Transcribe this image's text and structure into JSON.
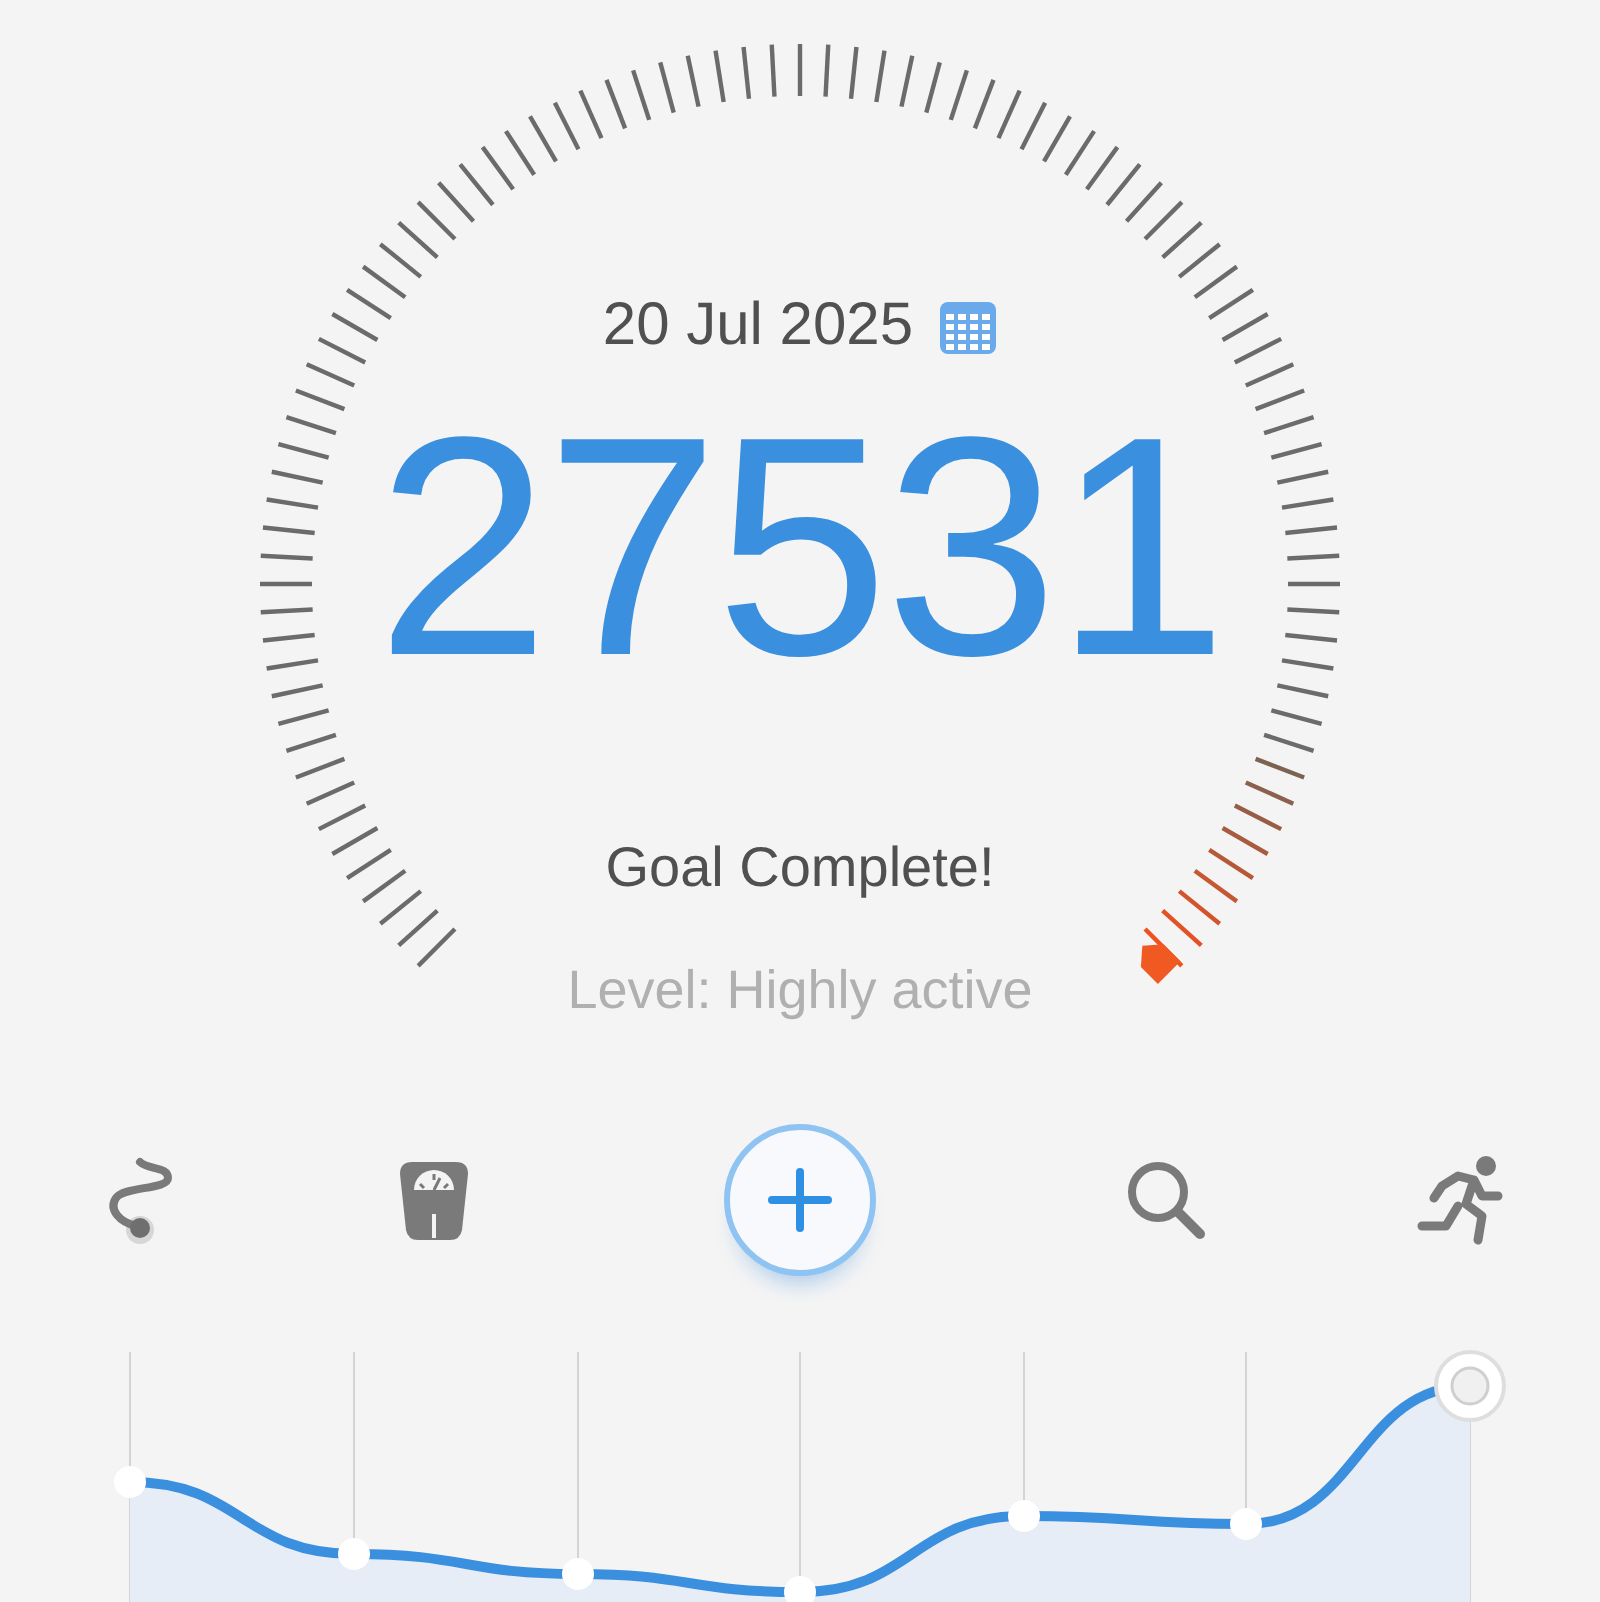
{
  "dial": {
    "date": "20 Jul 2025",
    "steps": "27531",
    "status": "Goal Complete!",
    "level_label": "Level: Highly active"
  },
  "toolbar": [
    {
      "kind": "route"
    },
    {
      "kind": "scale"
    },
    {
      "kind": "add"
    },
    {
      "kind": "search"
    },
    {
      "kind": "runner"
    }
  ]
}
